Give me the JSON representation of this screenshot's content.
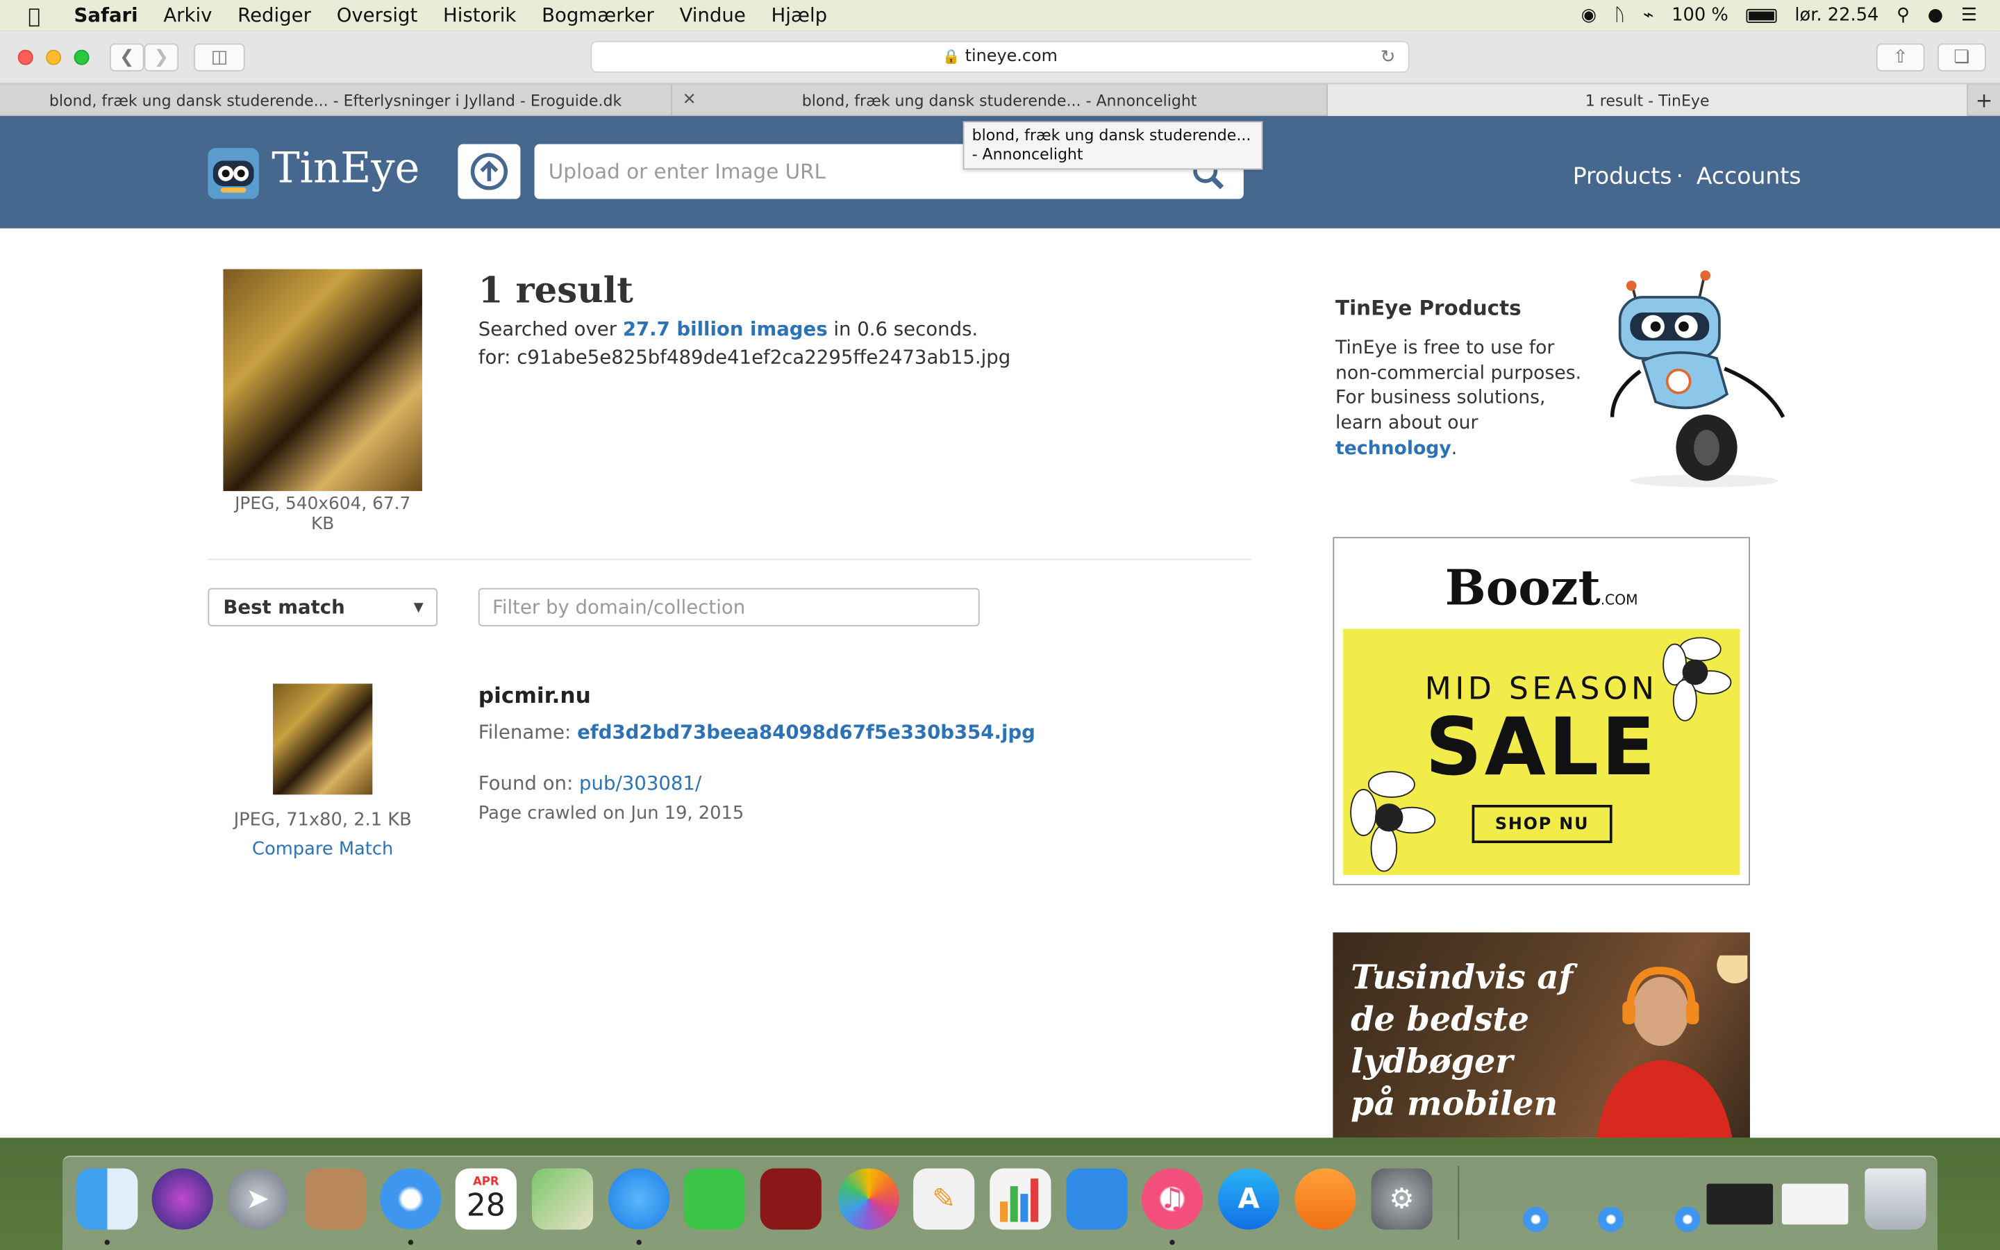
{
  "menubar": {
    "app": "Safari",
    "items": [
      "Arkiv",
      "Rediger",
      "Oversigt",
      "Historik",
      "Bogmærker",
      "Vindue",
      "Hjælp"
    ],
    "battery": "100 %",
    "clock": "lør. 22.54"
  },
  "toolbar": {
    "url": "tineye.com"
  },
  "tabs": [
    {
      "label": "blond, fræk ung dansk studerende... - Efterlysninger i Jylland - Eroguide.dk"
    },
    {
      "label": "blond, fræk ung dansk studerende... - Annoncelight"
    },
    {
      "label": "1 result - TinEye"
    }
  ],
  "tooltip": {
    "text": "blond, fræk ung dansk studerende... - Annoncelight"
  },
  "header": {
    "logo_text": "TinEye",
    "search_placeholder": "Upload or enter Image URL",
    "nav": [
      "Products",
      "Accounts"
    ],
    "separator": "·"
  },
  "result": {
    "title": "1 result",
    "searched_prefix": "Searched over ",
    "searched_link": "27.7 billion images",
    "searched_suffix": " in 0.6 seconds.",
    "for_line": "for: c91abe5e825bf489de41ef2ca2295ffe2473ab15.jpg",
    "query_meta": "JPEG, 540x604, 67.7 KB"
  },
  "controls": {
    "sort_label": "Best match",
    "filter_placeholder": "Filter by domain/collection"
  },
  "match": {
    "domain": "picmir.nu",
    "filename_label": "Filename: ",
    "filename": "efd3d2bd73beea84098d67f5e330b354.jpg",
    "found_label": "Found on: ",
    "found_link": "pub/303081/",
    "crawled": "Page crawled on Jun 19, 2015",
    "meta": "JPEG, 71x80, 2.1 KB",
    "compare": "Compare Match"
  },
  "sidebar": {
    "title": "TinEye Products",
    "text_prefix": "TinEye is free to use for non-commercial purposes. For business solutions, learn about our ",
    "text_link": "technology",
    "text_suffix": "."
  },
  "ad_boozt": {
    "brand": "Boozt",
    "brand_suffix": ".COM",
    "line1": "MID SEASON",
    "line2": "SALE",
    "button": "SHOP NU"
  },
  "ad_audio": {
    "lines": [
      "Tusindvis af",
      "de bedste",
      "lydbøger",
      "på mobilen"
    ]
  },
  "dock": {
    "calendar_month": "APR",
    "calendar_day": "28"
  },
  "colors": {
    "tineye_blue": "#46688f",
    "link_blue": "#2c72b7",
    "boozt_yellow": "#f2ec4a"
  }
}
